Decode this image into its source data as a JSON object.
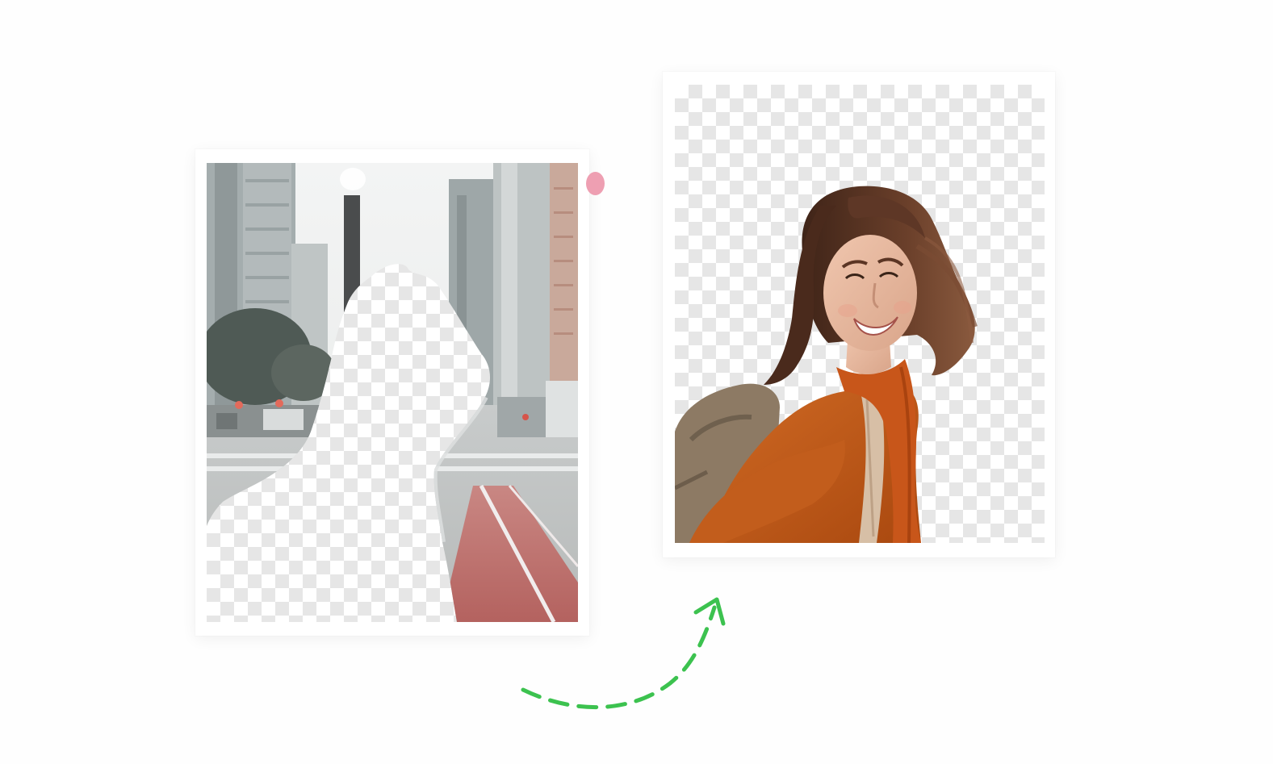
{
  "illustration": {
    "left_card": {
      "kind": "original-photo-with-partial-cutout",
      "subject_state": "removed"
    },
    "right_card": {
      "kind": "extracted-subject-on-transparent",
      "subject_state": "isolated"
    },
    "connector": {
      "icon": "curved-dashed-arrow-icon",
      "direction": "left-to-right"
    },
    "handle": {
      "icon": "drag-handle-icon"
    }
  },
  "colors": {
    "background": "#fefefe",
    "card": "#ffffff",
    "checker_dark": "#e6e6e6",
    "checker_light": "#ffffff",
    "arrow": "#3cc24f",
    "handle": "#ee9fb2",
    "sweater": "#c0581a",
    "hair": "#5b3524",
    "skin": "#e7b79e",
    "backpack": "#8d7a64",
    "bike_lane": "#b8696a"
  }
}
